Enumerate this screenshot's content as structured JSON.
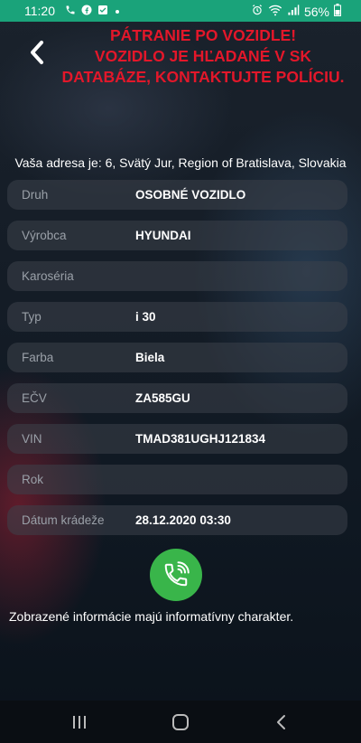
{
  "status_bar": {
    "time": "11:20",
    "battery": "56%",
    "left_icons": [
      "phone-icon",
      "facebook-icon",
      "message-icon",
      "dot-icon"
    ],
    "right_icons": [
      "alarm-icon",
      "wifi-icon",
      "signal-icon",
      "battery-icon"
    ]
  },
  "header": {
    "alert_line1": "PÁTRANIE PO VOZIDLE!",
    "alert_line2": "VOZIDLO JE HĽADANÉ V SK",
    "alert_line3": "DATABÁZE, KONTAKTUJTE POLÍCIU.",
    "alert_color": "#e3172a"
  },
  "address_text": "Vaša adresa je: 6, Svätý Jur, Region of Bratislava, Slovakia",
  "vehicle": {
    "rows": [
      {
        "label": "Druh",
        "value": "OSOBNÉ VOZIDLO"
      },
      {
        "label": "Výrobca",
        "value": "HYUNDAI"
      },
      {
        "label": "Karoséria",
        "value": ""
      },
      {
        "label": "Typ",
        "value": "i 30"
      },
      {
        "label": "Farba",
        "value": "Biela"
      },
      {
        "label": "EČV",
        "value": "ZA585GU"
      },
      {
        "label": "VIN",
        "value": "TMAD381UGHJ121834"
      },
      {
        "label": "Rok",
        "value": ""
      },
      {
        "label": "Dátum krádeže",
        "value": "28.12.2020 03:30"
      }
    ]
  },
  "call_button": {
    "icon": "phone-call-icon",
    "color": "#39b54a"
  },
  "footer_note": "Zobrazené informácie majú informatívny charakter.",
  "navbar": {
    "icons": [
      "recent-apps-icon",
      "home-icon",
      "back-nav-icon"
    ]
  }
}
